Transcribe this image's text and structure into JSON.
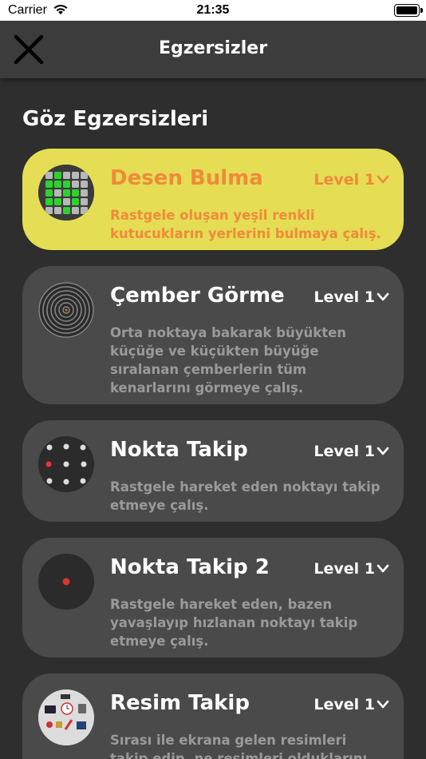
{
  "status_bar": {
    "carrier": "Carrier",
    "time": "21:35"
  },
  "nav": {
    "title": "Egzersizler",
    "close_icon": "close-icon"
  },
  "section_title": "Göz Egzersizleri",
  "colors": {
    "active_card": "#e5dd54",
    "active_text": "#f08a3a",
    "card": "#4a4a4a",
    "background": "#2e2e2e"
  },
  "exercises": [
    {
      "name": "Desen Bulma",
      "level": "Level 1",
      "description": "Rastgele oluşan yeşil renkli kutucukların yerlerini bulmaya çalış.",
      "icon": "grid-pattern-icon",
      "active": true
    },
    {
      "name": "Çember Görme",
      "level": "Level 1",
      "description": "Orta noktaya bakarak büyükten küçüğe ve küçükten büyüğe sıralanan çemberlerin tüm kenarlarını görmeye çalış.",
      "icon": "concentric-circles-icon",
      "active": false
    },
    {
      "name": "Nokta Takip",
      "level": "Level 1",
      "description": "Rastgele hareket eden noktayı takip etmeye çalış.",
      "icon": "dots-icon",
      "active": false
    },
    {
      "name": "Nokta Takip 2",
      "level": "Level 1",
      "description": "Rastgele hareket eden, bazen yavaşlayıp hızlanan noktayı takip etmeye çalış.",
      "icon": "single-dot-icon",
      "active": false
    },
    {
      "name": "Resim Takip",
      "level": "Level 1",
      "description": "Sırası ile ekrana gelen resimleri takip edin, ne resimleri olduklarını",
      "icon": "pictures-icon",
      "active": false
    }
  ]
}
